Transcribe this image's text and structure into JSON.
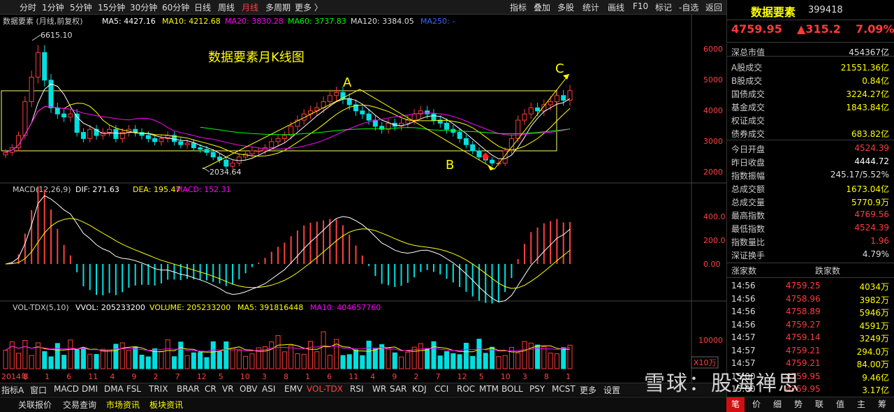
{
  "toolbar": {
    "left": [
      "分时",
      "1分钟",
      "5分钟",
      "15分钟",
      "30分钟",
      "60分钟",
      "日线",
      "周线",
      "月线",
      "多周期",
      "更多 〉"
    ],
    "active": "月线",
    "right": [
      "指标",
      "叠加",
      "多股",
      "统计",
      "画线",
      "F10",
      "标记",
      "-自选",
      "返回"
    ]
  },
  "header": {
    "name_line": "数据要素 (月线,前复权)",
    "ma": [
      {
        "label": "MA5: 4427.16",
        "color": "#ffffff"
      },
      {
        "label": "MA10: 4212.68",
        "color": "#ffff00"
      },
      {
        "label": "MA20: 3830.28",
        "color": "#ff00ff"
      },
      {
        "label": "MA60: 3737.83",
        "color": "#00ff00"
      },
      {
        "label": "MA120: 3384.05",
        "color": "#dddddd"
      },
      {
        "label": "MA250: -",
        "color": "#3366ff"
      }
    ]
  },
  "annotations": {
    "title": "数据要素月K线图",
    "A": "A",
    "B": "B",
    "C": "C",
    "high": "6615.10",
    "low": "2034.64"
  },
  "price_axis": [
    "6000",
    "5000",
    "4000",
    "3000",
    "2000"
  ],
  "macd": {
    "label": "MACD(12,26,9)",
    "dif": "DIF: 271.63",
    "dea": "DEA: 195.47",
    "macd": "MACD: 152.31",
    "axis": [
      "400.0",
      "200.0",
      "0.00"
    ]
  },
  "vol": {
    "label": "VOL-TDX(5,10)",
    "vvol": "VVOL: 205233200",
    "volume": "VOLUME: 205233200",
    "ma5": "MA5: 391816448",
    "ma10": "MA10: 404657760",
    "axis": "10000",
    "unit": "X10万"
  },
  "time_axis": [
    "2014年",
    "8",
    "1",
    "6",
    "11",
    "4",
    "9",
    "2",
    "7",
    "12",
    "5",
    "10",
    "3",
    "8",
    "1",
    "6",
    "11",
    "4",
    "9",
    "2",
    "7",
    "12",
    "5",
    "10",
    "3",
    "8",
    "1"
  ],
  "indicator_tabs": [
    "指标A",
    "窗口",
    "MACD",
    "DMI",
    "DMA",
    "FSL",
    "TRIX",
    "BRAR",
    "CR",
    "VR",
    "OBV",
    "ASI",
    "EMV",
    "VOL-TDX",
    "RSI",
    "WR",
    "SAR",
    "KDJ",
    "CCI",
    "ROC",
    "MTM",
    "BOLL",
    "PSY",
    "MCST",
    "更多",
    "设置"
  ],
  "indicator_active": "VOL-TDX",
  "bottom_tabs": [
    "关联报价",
    "交易查询",
    "市场资讯",
    "板块资讯"
  ],
  "panel": {
    "name": "数据要素",
    "code": "399418",
    "price": "4759.95",
    "change": "▲315.2",
    "pct": "7.09%",
    "rows": [
      {
        "k": "深总市值",
        "v": "454367亿",
        "c": "#dddddd"
      },
      {
        "k": "A股成交",
        "v": "21551.36亿",
        "c": "#ffff00"
      },
      {
        "k": "B股成交",
        "v": "0.84亿",
        "c": "#ffff00"
      },
      {
        "k": "国债成交",
        "v": "3224.27亿",
        "c": "#ffff00"
      },
      {
        "k": "基金成交",
        "v": "1843.84亿",
        "c": "#ffff00"
      },
      {
        "k": "权证成交",
        "v": "",
        "c": "#ffff00"
      },
      {
        "k": "债券成交",
        "v": "683.82亿",
        "c": "#ffff00"
      },
      {
        "k": "今日开盘",
        "v": "4524.39",
        "c": "#ff3b3b"
      },
      {
        "k": "昨日收盘",
        "v": "4444.72",
        "c": "#ffffff"
      },
      {
        "k": "指数振幅",
        "v": "245.17/5.52%",
        "c": "#dddddd"
      },
      {
        "k": "总成交额",
        "v": "1673.04亿",
        "c": "#ffff00"
      },
      {
        "k": "总成交量",
        "v": "5770.9万",
        "c": "#ffff00"
      },
      {
        "k": "最高指数",
        "v": "4769.56",
        "c": "#ff3b3b"
      },
      {
        "k": "最低指数",
        "v": "4524.39",
        "c": "#ff3b3b"
      },
      {
        "k": "指数量比",
        "v": "1.96",
        "c": "#ff3b3b"
      },
      {
        "k": "深证换手",
        "v": "4.79%",
        "c": "#dddddd"
      }
    ],
    "up_label": "涨家数",
    "down_label": "跌家数",
    "ticks": [
      {
        "t": "14:56",
        "p": "4759.25",
        "v": "4034万"
      },
      {
        "t": "14:56",
        "p": "4758.96",
        "v": "3982万"
      },
      {
        "t": "14:56",
        "p": "4758.89",
        "v": "5946万"
      },
      {
        "t": "14:56",
        "p": "4759.27",
        "v": "4591万"
      },
      {
        "t": "14:57",
        "p": "4759.14",
        "v": "3249万"
      },
      {
        "t": "14:57",
        "p": "4759.21",
        "v": "294.0万"
      },
      {
        "t": "14:57",
        "p": "4759.21",
        "v": "84.00万"
      },
      {
        "t": "15:00",
        "p": "4759.95",
        "v": "9.46亿"
      },
      {
        "t": "15:00",
        "p": "4759.95",
        "v": "3.17亿"
      }
    ],
    "footer_tabs": [
      "笔",
      "价",
      "细",
      "势",
      "联",
      "值",
      "主",
      "筹"
    ],
    "footer_active": "笔"
  },
  "watermark": "雪球：股海禅思",
  "chart_data": {
    "type": "candlestick",
    "title": "数据要素月K线图",
    "period": "monthly",
    "price_range": [
      1800,
      6800
    ],
    "monthly_close": [
      2750,
      2900,
      3300,
      4400,
      5200,
      6000,
      5100,
      4200,
      4000,
      3900,
      4000,
      3400,
      3200,
      3500,
      3300,
      3400,
      3500,
      3200,
      3400,
      3500,
      3400,
      3300,
      3200,
      3100,
      3200,
      3300,
      3100,
      3000,
      3050,
      2900,
      2850,
      2750,
      2600,
      2500,
      2300,
      2400,
      2600,
      2700,
      2800,
      2800,
      2900,
      3100,
      3200,
      3300,
      3600,
      3800,
      4000,
      4100,
      4200,
      4400,
      4600,
      4700,
      4500,
      4300,
      4100,
      4000,
      3800,
      3600,
      3500,
      3700,
      3600,
      3700,
      3800,
      4000,
      4100,
      4000,
      3800,
      3700,
      3500,
      3400,
      3200,
      3000,
      2800,
      2600,
      2500,
      2400,
      2400,
      2800,
      3200,
      3800,
      4000,
      4200,
      4100,
      4300,
      4400,
      4600,
      4444.72,
      4759.95
    ]
  }
}
